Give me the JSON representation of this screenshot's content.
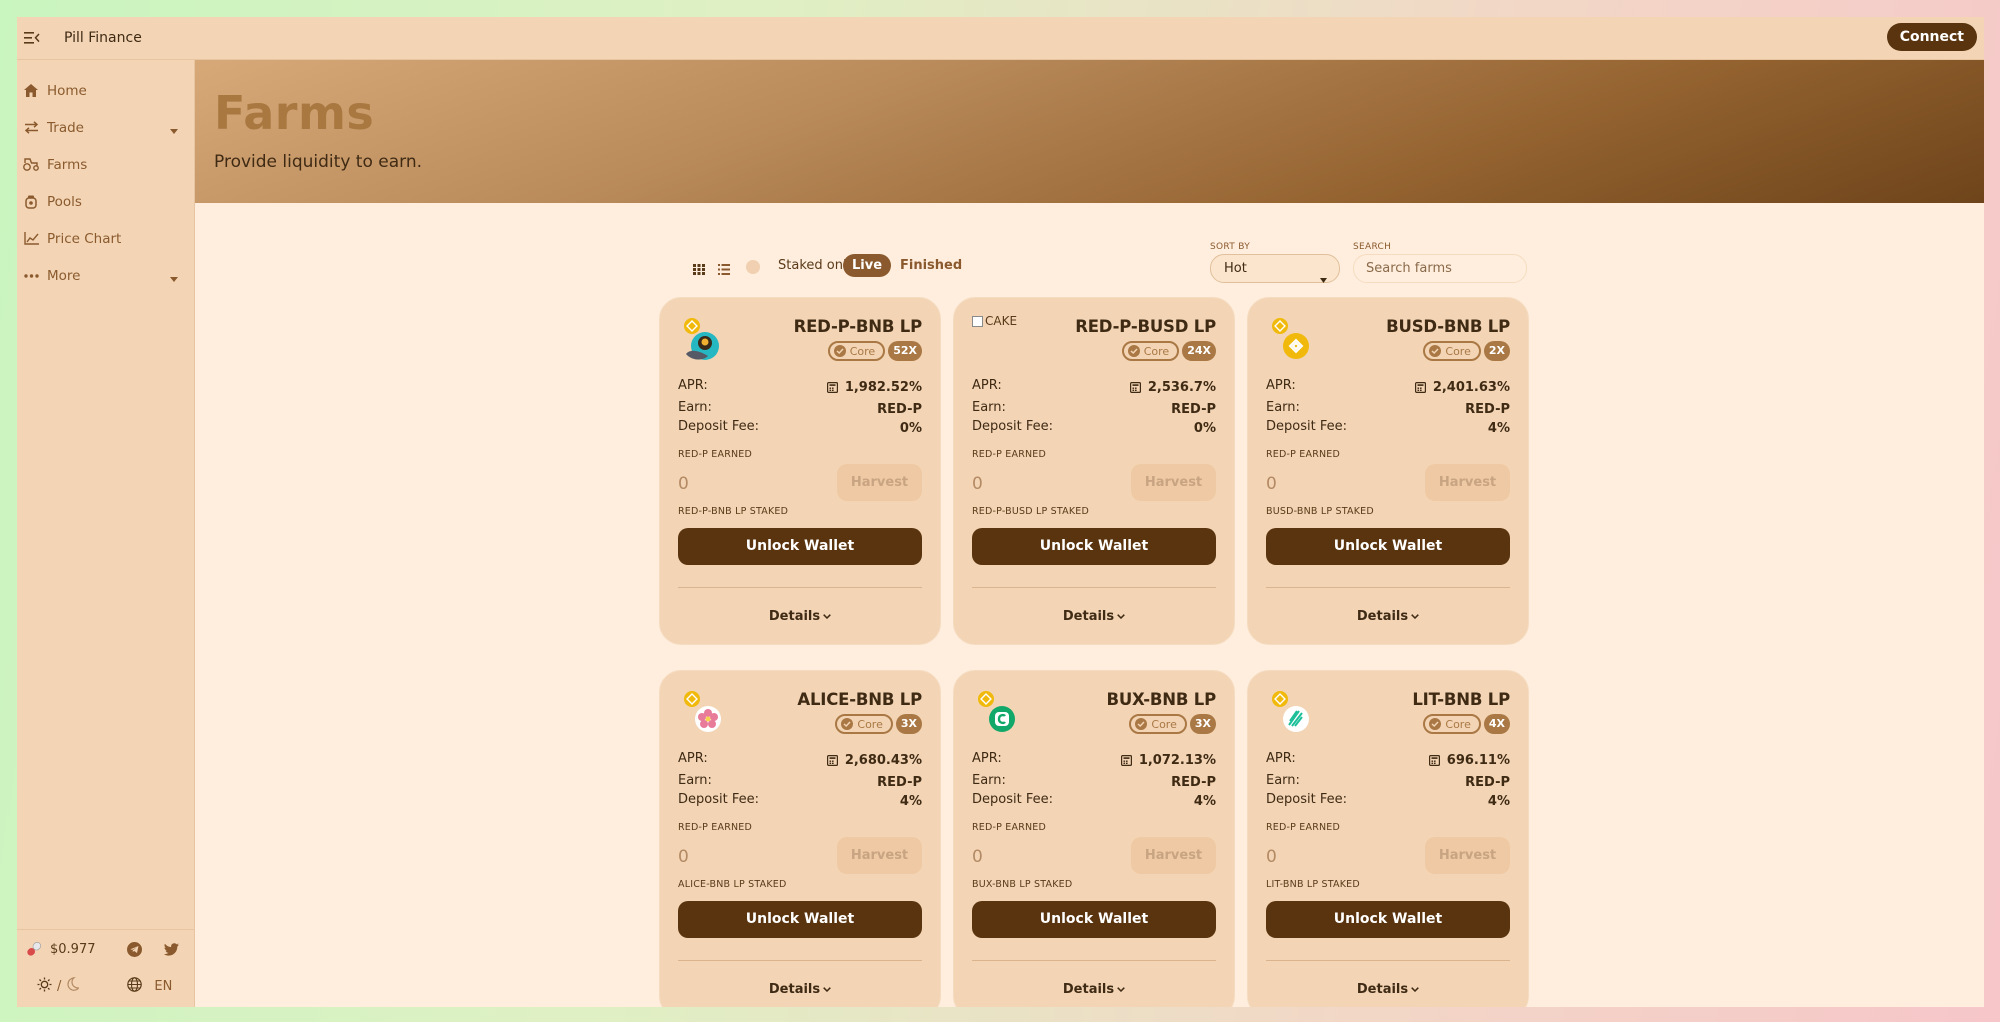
{
  "app": {
    "brand": "Pill Finance",
    "connect_label": "Connect"
  },
  "sidebar": {
    "items": [
      {
        "label": "Home",
        "icon": "home-icon"
      },
      {
        "label": "Trade",
        "icon": "trade-icon",
        "has_submenu": true
      },
      {
        "label": "Farms",
        "icon": "tractor-icon"
      },
      {
        "label": "Pools",
        "icon": "pool-icon"
      },
      {
        "label": "Price Chart",
        "icon": "chart-icon"
      },
      {
        "label": "More",
        "icon": "more-icon",
        "has_submenu": true
      }
    ],
    "price": "$0.977",
    "theme_separator": "/",
    "language": "EN"
  },
  "hero": {
    "title": "Farms",
    "subtitle": "Provide liquidity to earn."
  },
  "controls": {
    "staked_only_label": "Staked only",
    "tab_live": "Live",
    "tab_finished": "Finished",
    "sort_label": "SORT BY",
    "sort_value": "Hot",
    "search_label": "SEARCH",
    "search_placeholder": "Search farms"
  },
  "card_labels": {
    "apr": "APR:",
    "earn": "Earn:",
    "deposit_fee": "Deposit Fee:",
    "earned": "RED-P EARNED",
    "harvest": "Harvest",
    "unlock": "Unlock Wallet",
    "details": "Details",
    "core": "Core"
  },
  "farms": [
    {
      "name": "RED-P-BNB LP",
      "multiplier": "52X",
      "apr": "1,982.52%",
      "earn": "RED-P",
      "deposit_fee": "0%",
      "earned_value": "0",
      "staked_label": "RED-P-BNB LP STAKED",
      "token": "red-p-token-icon"
    },
    {
      "name": "RED-P-BUSD LP",
      "multiplier": "24X",
      "apr": "2,536.7%",
      "earn": "RED-P",
      "deposit_fee": "0%",
      "earned_value": "0",
      "staked_label": "RED-P-BUSD LP STAKED",
      "token": "broken-image-icon",
      "image_alt": "CAKE"
    },
    {
      "name": "BUSD-BNB LP",
      "multiplier": "2X",
      "apr": "2,401.63%",
      "earn": "RED-P",
      "deposit_fee": "4%",
      "earned_value": "0",
      "staked_label": "BUSD-BNB LP STAKED",
      "token": "busd-token-icon"
    },
    {
      "name": "ALICE-BNB LP",
      "multiplier": "3X",
      "apr": "2,680.43%",
      "earn": "RED-P",
      "deposit_fee": "4%",
      "earned_value": "0",
      "staked_label": "ALICE-BNB LP STAKED",
      "token": "alice-token-icon"
    },
    {
      "name": "BUX-BNB LP",
      "multiplier": "3X",
      "apr": "1,072.13%",
      "earn": "RED-P",
      "deposit_fee": "4%",
      "earned_value": "0",
      "staked_label": "BUX-BNB LP STAKED",
      "token": "bux-token-icon"
    },
    {
      "name": "LIT-BNB LP",
      "multiplier": "4X",
      "apr": "696.11%",
      "earn": "RED-P",
      "deposit_fee": "4%",
      "earned_value": "0",
      "staked_label": "LIT-BNB LP STAKED",
      "token": "lit-token-icon"
    }
  ],
  "colors": {
    "accent": "#5a340f",
    "panel": "#f3d5b5",
    "page_bg": "#ffeedd",
    "badge": "#a97845"
  }
}
